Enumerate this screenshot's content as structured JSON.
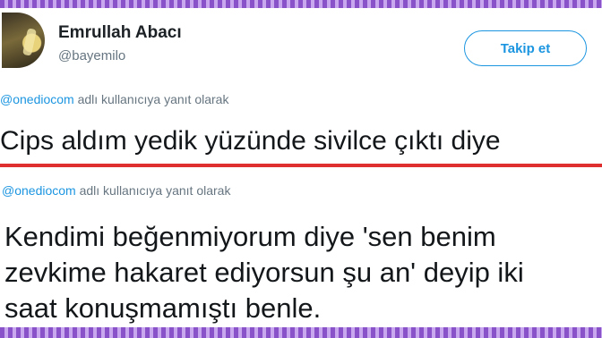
{
  "tweet1": {
    "author_name": "Emrullah Abacı",
    "author_handle": "@bayemilo",
    "follow_label": "Takip et",
    "reply_mention": "@onediocom",
    "reply_suffix": " adlı kullanıcıya yanıt olarak",
    "text": "Cips aldım yedik yüzünde sivilce çıktı diye"
  },
  "tweet2": {
    "reply_mention": "@onediocom",
    "reply_suffix": " adlı kullanıcıya yanıt olarak",
    "lines": [
      "Kendimi beğenmiyorum diye 'sen benim",
      "zevkime hakaret ediyorsun şu an' deyip iki",
      "saat konuşmamıştı benle."
    ]
  },
  "colors": {
    "accent": "#1b95e0",
    "divider": "#e02f2f",
    "frame_purple": "#8a52c9"
  }
}
